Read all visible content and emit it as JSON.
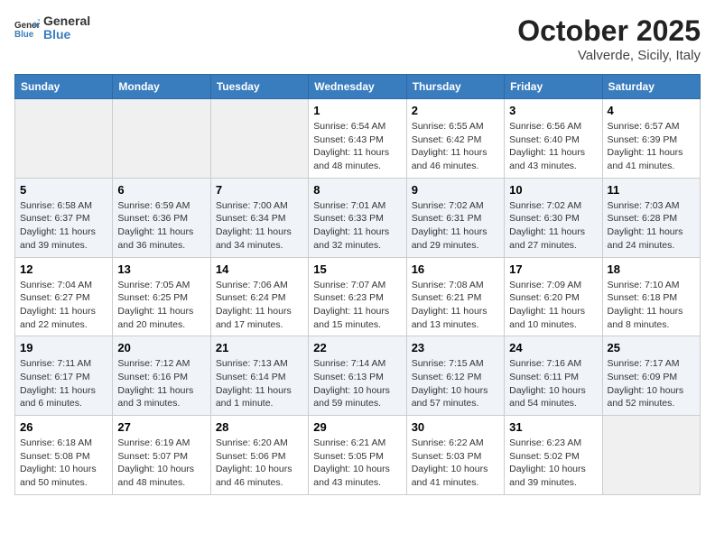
{
  "header": {
    "logo": "GeneralBlue",
    "month": "October 2025",
    "location": "Valverde, Sicily, Italy"
  },
  "weekdays": [
    "Sunday",
    "Monday",
    "Tuesday",
    "Wednesday",
    "Thursday",
    "Friday",
    "Saturday"
  ],
  "weeks": [
    [
      {
        "day": "",
        "text": ""
      },
      {
        "day": "",
        "text": ""
      },
      {
        "day": "",
        "text": ""
      },
      {
        "day": "1",
        "text": "Sunrise: 6:54 AM\nSunset: 6:43 PM\nDaylight: 11 hours\nand 48 minutes."
      },
      {
        "day": "2",
        "text": "Sunrise: 6:55 AM\nSunset: 6:42 PM\nDaylight: 11 hours\nand 46 minutes."
      },
      {
        "day": "3",
        "text": "Sunrise: 6:56 AM\nSunset: 6:40 PM\nDaylight: 11 hours\nand 43 minutes."
      },
      {
        "day": "4",
        "text": "Sunrise: 6:57 AM\nSunset: 6:39 PM\nDaylight: 11 hours\nand 41 minutes."
      }
    ],
    [
      {
        "day": "5",
        "text": "Sunrise: 6:58 AM\nSunset: 6:37 PM\nDaylight: 11 hours\nand 39 minutes."
      },
      {
        "day": "6",
        "text": "Sunrise: 6:59 AM\nSunset: 6:36 PM\nDaylight: 11 hours\nand 36 minutes."
      },
      {
        "day": "7",
        "text": "Sunrise: 7:00 AM\nSunset: 6:34 PM\nDaylight: 11 hours\nand 34 minutes."
      },
      {
        "day": "8",
        "text": "Sunrise: 7:01 AM\nSunset: 6:33 PM\nDaylight: 11 hours\nand 32 minutes."
      },
      {
        "day": "9",
        "text": "Sunrise: 7:02 AM\nSunset: 6:31 PM\nDaylight: 11 hours\nand 29 minutes."
      },
      {
        "day": "10",
        "text": "Sunrise: 7:02 AM\nSunset: 6:30 PM\nDaylight: 11 hours\nand 27 minutes."
      },
      {
        "day": "11",
        "text": "Sunrise: 7:03 AM\nSunset: 6:28 PM\nDaylight: 11 hours\nand 24 minutes."
      }
    ],
    [
      {
        "day": "12",
        "text": "Sunrise: 7:04 AM\nSunset: 6:27 PM\nDaylight: 11 hours\nand 22 minutes."
      },
      {
        "day": "13",
        "text": "Sunrise: 7:05 AM\nSunset: 6:25 PM\nDaylight: 11 hours\nand 20 minutes."
      },
      {
        "day": "14",
        "text": "Sunrise: 7:06 AM\nSunset: 6:24 PM\nDaylight: 11 hours\nand 17 minutes."
      },
      {
        "day": "15",
        "text": "Sunrise: 7:07 AM\nSunset: 6:23 PM\nDaylight: 11 hours\nand 15 minutes."
      },
      {
        "day": "16",
        "text": "Sunrise: 7:08 AM\nSunset: 6:21 PM\nDaylight: 11 hours\nand 13 minutes."
      },
      {
        "day": "17",
        "text": "Sunrise: 7:09 AM\nSunset: 6:20 PM\nDaylight: 11 hours\nand 10 minutes."
      },
      {
        "day": "18",
        "text": "Sunrise: 7:10 AM\nSunset: 6:18 PM\nDaylight: 11 hours\nand 8 minutes."
      }
    ],
    [
      {
        "day": "19",
        "text": "Sunrise: 7:11 AM\nSunset: 6:17 PM\nDaylight: 11 hours\nand 6 minutes."
      },
      {
        "day": "20",
        "text": "Sunrise: 7:12 AM\nSunset: 6:16 PM\nDaylight: 11 hours\nand 3 minutes."
      },
      {
        "day": "21",
        "text": "Sunrise: 7:13 AM\nSunset: 6:14 PM\nDaylight: 11 hours\nand 1 minute."
      },
      {
        "day": "22",
        "text": "Sunrise: 7:14 AM\nSunset: 6:13 PM\nDaylight: 10 hours\nand 59 minutes."
      },
      {
        "day": "23",
        "text": "Sunrise: 7:15 AM\nSunset: 6:12 PM\nDaylight: 10 hours\nand 57 minutes."
      },
      {
        "day": "24",
        "text": "Sunrise: 7:16 AM\nSunset: 6:11 PM\nDaylight: 10 hours\nand 54 minutes."
      },
      {
        "day": "25",
        "text": "Sunrise: 7:17 AM\nSunset: 6:09 PM\nDaylight: 10 hours\nand 52 minutes."
      }
    ],
    [
      {
        "day": "26",
        "text": "Sunrise: 6:18 AM\nSunset: 5:08 PM\nDaylight: 10 hours\nand 50 minutes."
      },
      {
        "day": "27",
        "text": "Sunrise: 6:19 AM\nSunset: 5:07 PM\nDaylight: 10 hours\nand 48 minutes."
      },
      {
        "day": "28",
        "text": "Sunrise: 6:20 AM\nSunset: 5:06 PM\nDaylight: 10 hours\nand 46 minutes."
      },
      {
        "day": "29",
        "text": "Sunrise: 6:21 AM\nSunset: 5:05 PM\nDaylight: 10 hours\nand 43 minutes."
      },
      {
        "day": "30",
        "text": "Sunrise: 6:22 AM\nSunset: 5:03 PM\nDaylight: 10 hours\nand 41 minutes."
      },
      {
        "day": "31",
        "text": "Sunrise: 6:23 AM\nSunset: 5:02 PM\nDaylight: 10 hours\nand 39 minutes."
      },
      {
        "day": "",
        "text": ""
      }
    ]
  ]
}
